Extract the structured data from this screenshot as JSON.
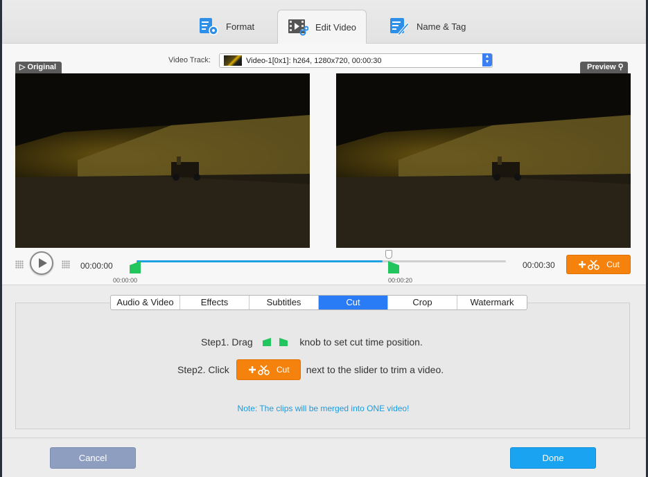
{
  "toolbar": {
    "tabs": [
      {
        "label": "Format",
        "icon": "format-settings-icon"
      },
      {
        "label": "Edit Video",
        "icon": "video-scissors-icon",
        "active": true
      },
      {
        "label": "Name & Tag",
        "icon": "edit-tag-icon"
      }
    ]
  },
  "video": {
    "track_label": "Video Track:",
    "track_value": "Video-1[0x1]: h264, 1280x720, 00:00:30",
    "original_tag": "Original",
    "preview_tag": "Preview"
  },
  "timeline": {
    "start_time": "00:00:00",
    "end_time": "00:00:30",
    "left_knob_label": "00:00:00",
    "right_knob_label": "00:00:20",
    "cut_label": "Cut",
    "selection_fraction": 0.6667,
    "accent": "#1da1e2"
  },
  "tabs": [
    "Audio & Video",
    "Effects",
    "Subtitles",
    "Cut",
    "Crop",
    "Watermark"
  ],
  "active_tab": "Cut",
  "panel": {
    "step1_a": "Step1. Drag",
    "step1_b": "knob to set cut time position.",
    "step2_a": "Step2. Click",
    "step2_cut": "Cut",
    "step2_b": "next to the slider to trim a video.",
    "note": "Note: The clips will be merged into ONE video!"
  },
  "footer": {
    "cancel_label": "Cancel",
    "done_label": "Done"
  },
  "colors": {
    "cut_orange": "#f4820c",
    "tab_active": "#2a7cf6",
    "done_blue": "#1aa3f0",
    "knob_green": "#22c55e"
  }
}
